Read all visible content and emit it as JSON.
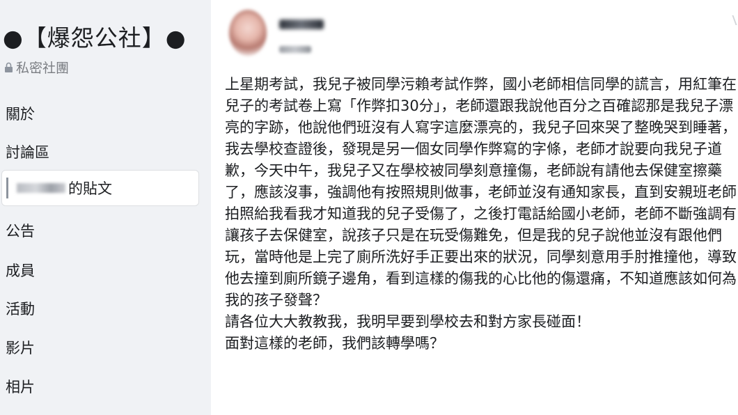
{
  "sidebar": {
    "group_name": "●【爆怨公社】●",
    "privacy": "私密社團",
    "nav": {
      "about": "關於",
      "discussion": "討論區",
      "my_posts_suffix": "的貼文",
      "announcements": "公告",
      "members": "成員",
      "events": "活動",
      "videos": "影片",
      "photos": "相片"
    }
  },
  "post": {
    "paragraphs": [
      "上星期考試，我兒子被同學污賴考試作弊，國小老師相信同學的謊言，用紅筆在兒子的考試卷上寫「作弊扣30分」，老師還跟我說他百分之百確認那是我兒子漂亮的字跡，他說他們班沒有人寫字這麼漂亮的，我兒子回來哭了整晚哭到睡著，我去學校查證後，發現是另一個女同學作弊寫的字條，老師才說要向我兒子道歉，今天中午，我兒子又在學校被同學刻意撞傷，老師說有請他去保健室擦藥了，應該沒事，強調他有按照規則做事，老師並沒有通知家長，直到安親班老師拍照給我看我才知道我的兒子受傷了，之後打電話給國小老師，老師不斷強調有讓孩子去保健室，說孩子只是在玩受傷難免，但是我的兒子說他並沒有跟他們玩，當時他是上完了廁所洗好手正要出來的狀況，同學刻意用手肘推撞他，導致他去撞到廁所鏡子邊角，看到這樣的傷我的心比他的傷還痛，不知道應該如何為我的孩子發聲？",
      "請各位大大教教我，我明早要到學校去和對方家長碰面！",
      "面對這樣的老師，我們該轉學嗎？"
    ]
  },
  "colors": {
    "sidebar_bg": "#f0f2f5",
    "text": "#1c1e21",
    "muted": "#7a7d82"
  }
}
